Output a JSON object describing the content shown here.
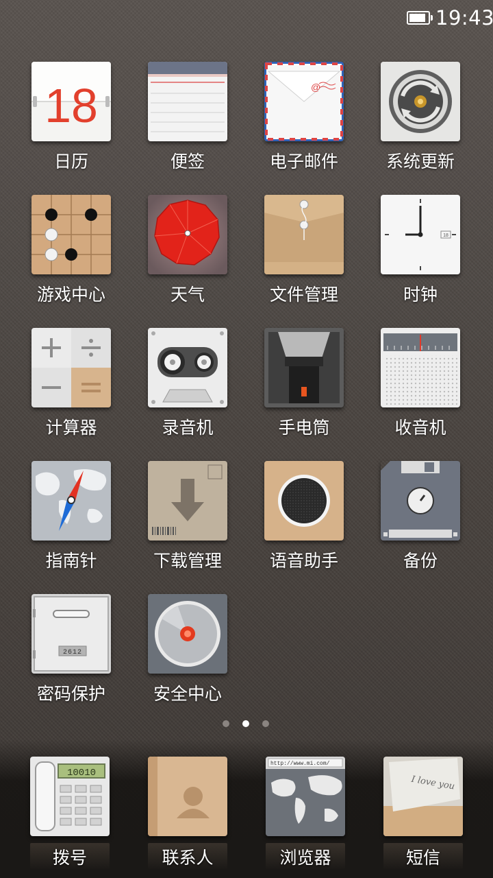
{
  "status_bar": {
    "time": "19:43",
    "battery_level": 0.9
  },
  "apps": [
    {
      "id": "calendar",
      "label": "日历",
      "date": "18"
    },
    {
      "id": "notes",
      "label": "便签"
    },
    {
      "id": "email",
      "label": "电子邮件"
    },
    {
      "id": "system-update",
      "label": "系统更新"
    },
    {
      "id": "game-center",
      "label": "游戏中心"
    },
    {
      "id": "weather",
      "label": "天气"
    },
    {
      "id": "file-manager",
      "label": "文件管理"
    },
    {
      "id": "clock",
      "label": "时钟",
      "date": "18"
    },
    {
      "id": "calculator",
      "label": "计算器"
    },
    {
      "id": "recorder",
      "label": "录音机"
    },
    {
      "id": "flashlight",
      "label": "手电筒"
    },
    {
      "id": "radio",
      "label": "收音机"
    },
    {
      "id": "compass",
      "label": "指南针"
    },
    {
      "id": "downloads",
      "label": "下载管理"
    },
    {
      "id": "voice-assistant",
      "label": "语音助手"
    },
    {
      "id": "backup",
      "label": "备份"
    },
    {
      "id": "password-protect",
      "label": "密码保护",
      "code": "2612"
    },
    {
      "id": "security-center",
      "label": "安全中心"
    }
  ],
  "page_indicator": {
    "pages": 3,
    "current": 2
  },
  "dock": [
    {
      "id": "dialer",
      "label": "拨号",
      "display": "10010"
    },
    {
      "id": "contacts",
      "label": "联系人"
    },
    {
      "id": "browser",
      "label": "浏览器",
      "url": "http://www.mi.com/"
    },
    {
      "id": "messages",
      "label": "短信",
      "note": "I love you"
    }
  ]
}
